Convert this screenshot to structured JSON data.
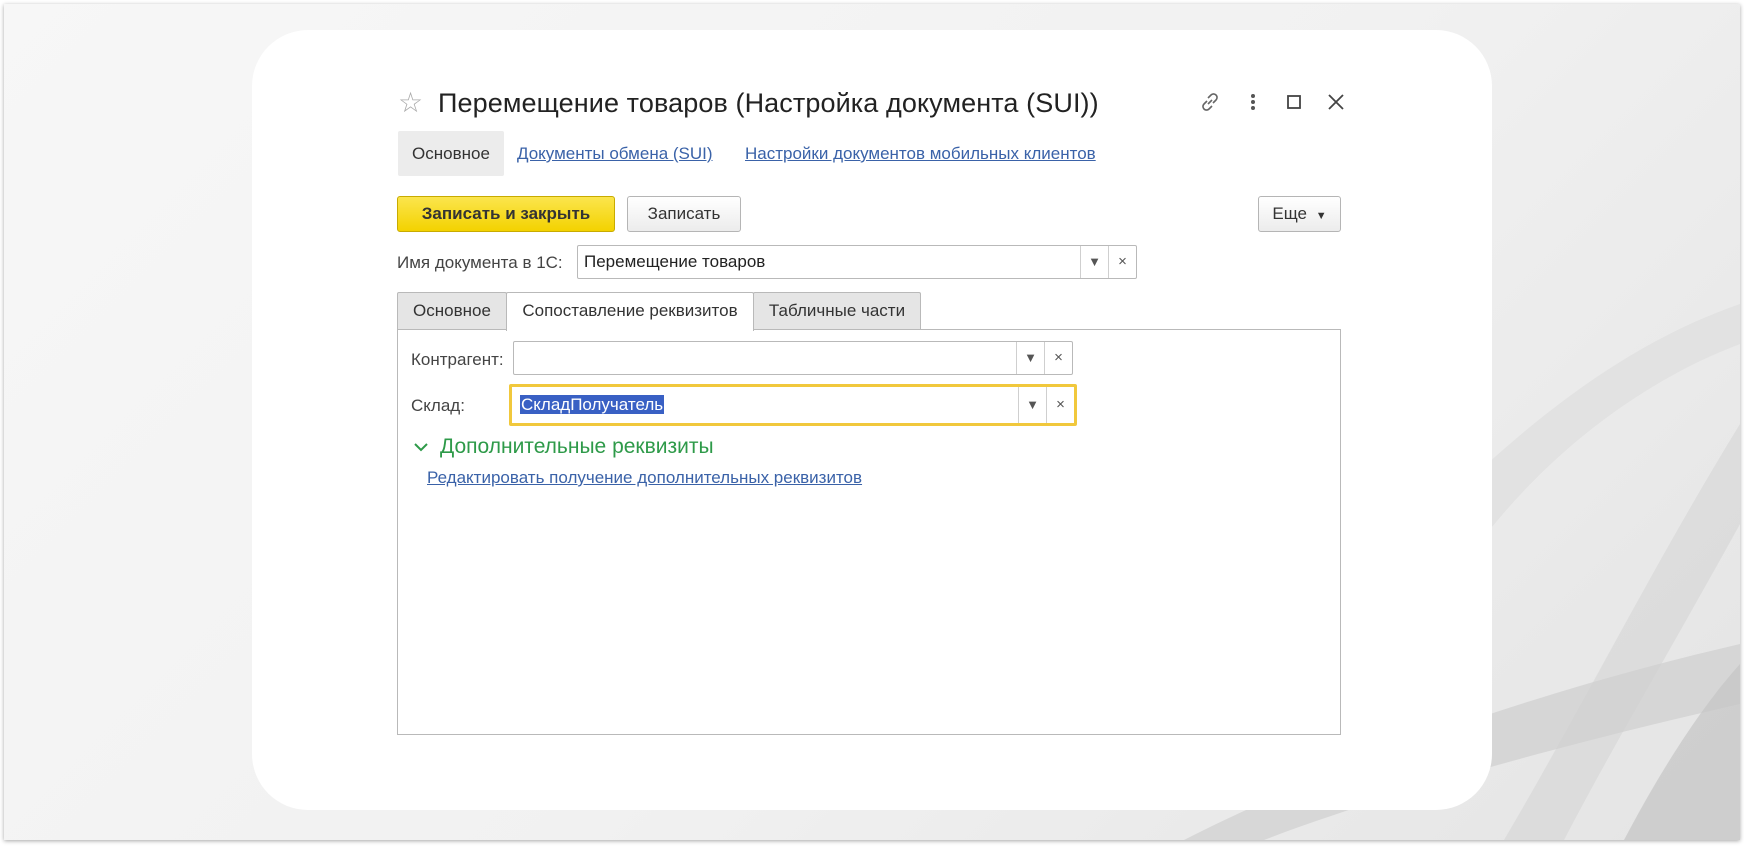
{
  "window": {
    "title": "Перемещение товаров (Настройка документа (SUI))"
  },
  "nav": {
    "active": "Основное",
    "links": [
      "Документы обмена (SUI)",
      "Настройки документов мобильных клиентов"
    ]
  },
  "toolbar": {
    "save_close_label": "Записать и закрыть",
    "save_label": "Записать",
    "more_label": "Еще"
  },
  "doc_name": {
    "label": "Имя документа в 1С:",
    "value": "Перемещение товаров"
  },
  "tabs": [
    "Основное",
    "Сопоставление реквизитов",
    "Табличные части"
  ],
  "active_tab": "Сопоставление реквизитов",
  "fields": {
    "counterparty": {
      "label": "Контрагент:",
      "value": ""
    },
    "warehouse": {
      "label": "Склад:",
      "value": "СкладПолучатель"
    }
  },
  "extra": {
    "group_title": "Дополнительные реквизиты",
    "edit_link": "Редактировать получение дополнительных реквизитов"
  },
  "colors": {
    "accent_yellow": "#f3d200",
    "focus_border": "#f1c83c",
    "link_blue": "#3a62a8",
    "group_green": "#2e9a49",
    "selection": "#3960c4"
  },
  "icons": [
    "star-icon",
    "link-icon",
    "more-vertical-icon",
    "maximize-icon",
    "close-icon",
    "chevron-down-icon",
    "clear-icon"
  ]
}
